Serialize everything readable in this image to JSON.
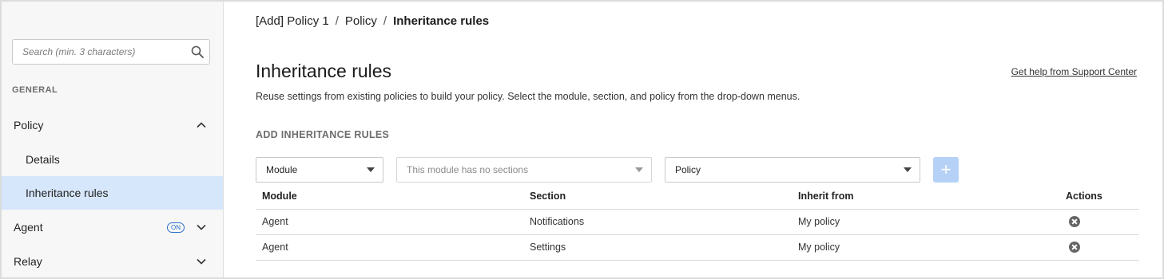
{
  "sidebar": {
    "search": {
      "placeholder": "Search (min. 3 characters)",
      "icon": "search-icon"
    },
    "section_label": "GENERAL",
    "items": [
      {
        "label": "Policy",
        "expanded": true
      },
      {
        "label": "Details"
      },
      {
        "label": "Inheritance rules",
        "active": true
      },
      {
        "label": "Agent",
        "badge": "ON"
      },
      {
        "label": "Relay"
      }
    ]
  },
  "breadcrumb": {
    "items": [
      "[Add] Policy 1",
      "Policy",
      "Inheritance rules"
    ],
    "separator": "/"
  },
  "header": {
    "title": "Inheritance rules",
    "help_link": "Get help from Support Center",
    "description": "Reuse settings from existing policies to build your policy. Select the module, section, and policy from the drop-down menus."
  },
  "add_rules": {
    "label": "ADD INHERITANCE RULES",
    "module_select": "Module",
    "section_select": "This module has no sections",
    "policy_select": "Policy",
    "add_button": "+"
  },
  "table": {
    "columns": [
      "Module",
      "Section",
      "Inherit from",
      "Actions"
    ],
    "rows": [
      {
        "module": "Agent",
        "section": "Notifications",
        "inherit_from": "My policy"
      },
      {
        "module": "Agent",
        "section": "Settings",
        "inherit_from": "My policy"
      }
    ]
  },
  "colors": {
    "active_nav": "#d6e6fb",
    "add_button": "#b5d2f6",
    "badge": "#2a6fc9",
    "sidebar_bg": "#f7f7f7"
  }
}
